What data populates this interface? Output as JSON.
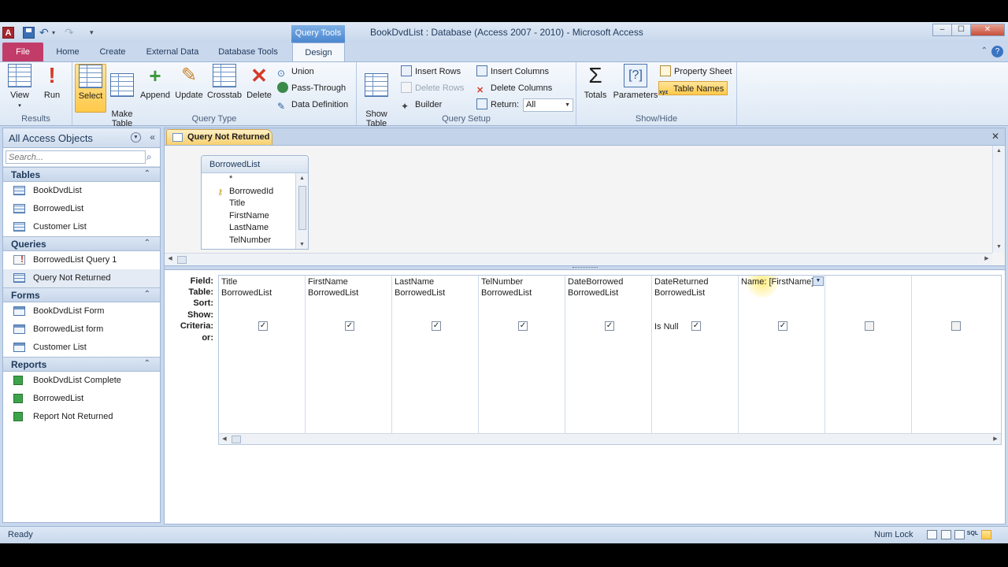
{
  "window": {
    "title": "BookDvdList : Database (Access 2007 - 2010)  -  Microsoft Access",
    "app_icon": "A",
    "context_tab_header": "Query Tools",
    "controls": {
      "minimize": "‒",
      "maximize": "☐",
      "close": "✕"
    }
  },
  "tabs": {
    "file": "File",
    "home": "Home",
    "create": "Create",
    "external": "External Data",
    "dbtools": "Database Tools",
    "design": "Design"
  },
  "ribbon": {
    "results": {
      "label": "Results",
      "view": "View",
      "run": "Run"
    },
    "query_type": {
      "label": "Query Type",
      "select": "Select",
      "make_table": "Make\nTable",
      "append": "Append",
      "update": "Update",
      "crosstab": "Crosstab",
      "delete": "Delete",
      "union": "Union",
      "pass_through": "Pass-Through",
      "data_definition": "Data Definition"
    },
    "query_setup": {
      "label": "Query Setup",
      "show_table": "Show\nTable",
      "insert_rows": "Insert Rows",
      "delete_rows": "Delete Rows",
      "builder": "Builder",
      "insert_columns": "Insert Columns",
      "delete_columns": "Delete Columns",
      "return_label": "Return:",
      "return_value": "All"
    },
    "show_hide": {
      "label": "Show/Hide",
      "totals": "Totals",
      "parameters": "Parameters",
      "property_sheet": "Property Sheet",
      "table_names": "Table Names"
    }
  },
  "nav": {
    "title": "All Access Objects",
    "search_placeholder": "Search...",
    "sections": [
      {
        "label": "Tables",
        "items": [
          "BookDvdList",
          "BorrowedList",
          "Customer List"
        ]
      },
      {
        "label": "Queries",
        "items": [
          "BorrowedList Query 1",
          "Query Not Returned"
        ]
      },
      {
        "label": "Forms",
        "items": [
          "BookDvdList Form",
          "BorrowedList form",
          "Customer List"
        ]
      },
      {
        "label": "Reports",
        "items": [
          "BookDvdList Complete",
          "BorrowedList",
          "Report Not Returned"
        ]
      }
    ]
  },
  "document": {
    "tab_label": "Query Not Returned",
    "field_list": {
      "title": "BorrowedList",
      "fields": [
        "*",
        "BorrowedId",
        "Title",
        "FirstName",
        "LastName",
        "TelNumber"
      ]
    },
    "grid": {
      "row_labels": [
        "Field:",
        "Table:",
        "Sort:",
        "Show:",
        "Criteria:",
        "or:"
      ],
      "columns": [
        {
          "field": "Title",
          "table": "BorrowedList",
          "show": true,
          "criteria": ""
        },
        {
          "field": "FirstName",
          "table": "BorrowedList",
          "show": true,
          "criteria": ""
        },
        {
          "field": "LastName",
          "table": "BorrowedList",
          "show": true,
          "criteria": ""
        },
        {
          "field": "TelNumber",
          "table": "BorrowedList",
          "show": true,
          "criteria": ""
        },
        {
          "field": "DateBorrowed",
          "table": "BorrowedList",
          "show": true,
          "criteria": ""
        },
        {
          "field": "DateReturned",
          "table": "BorrowedList",
          "show": true,
          "criteria": "Is Null"
        },
        {
          "field": "Name: [FirstName]",
          "table": "",
          "show": true,
          "criteria": ""
        },
        {
          "field": "",
          "table": "",
          "show": false,
          "criteria": ""
        },
        {
          "field": "",
          "table": "",
          "show": false,
          "criteria": ""
        }
      ]
    }
  },
  "status": {
    "text": "Ready",
    "numlock": "Num Lock",
    "sql": "SQL"
  }
}
